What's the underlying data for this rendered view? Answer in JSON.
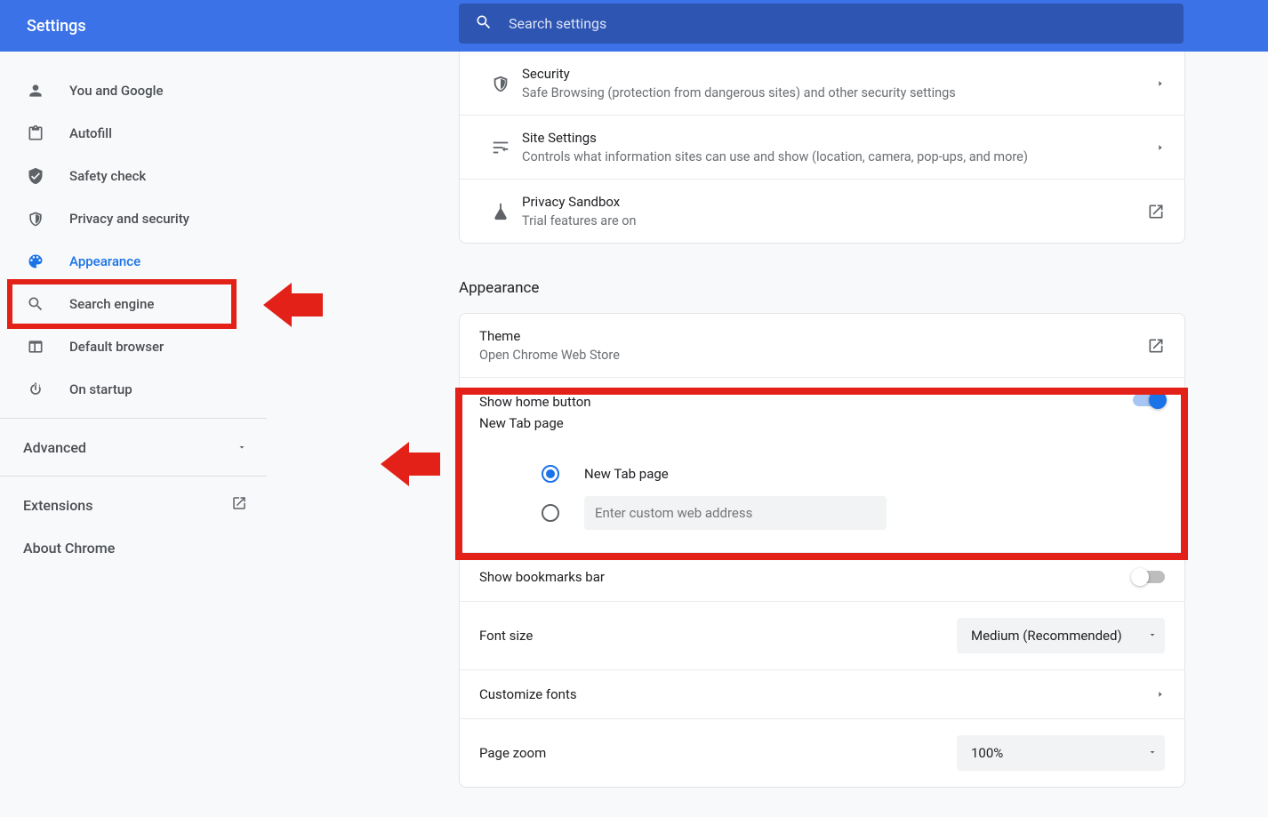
{
  "header": {
    "title": "Settings",
    "search_placeholder": "Search settings"
  },
  "sidebar": {
    "items": [
      {
        "label": "You and Google"
      },
      {
        "label": "Autofill"
      },
      {
        "label": "Safety check"
      },
      {
        "label": "Privacy and security"
      },
      {
        "label": "Appearance"
      },
      {
        "label": "Search engine"
      },
      {
        "label": "Default browser"
      },
      {
        "label": "On startup"
      }
    ],
    "advanced_label": "Advanced",
    "extensions_label": "Extensions",
    "about_label": "About Chrome"
  },
  "privacy_section": {
    "rows": [
      {
        "title": "Security",
        "sub": "Safe Browsing (protection from dangerous sites) and other security settings"
      },
      {
        "title": "Site Settings",
        "sub": "Controls what information sites can use and show (location, camera, pop-ups, and more)"
      },
      {
        "title": "Privacy Sandbox",
        "sub": "Trial features are on"
      }
    ]
  },
  "appearance": {
    "heading": "Appearance",
    "theme_title": "Theme",
    "theme_sub": "Open Chrome Web Store",
    "show_home_title": "Show home button",
    "show_home_sub": "New Tab page",
    "radio_newtab_label": "New Tab page",
    "custom_url_placeholder": "Enter custom web address",
    "show_bookmarks_label": "Show bookmarks bar",
    "font_size_label": "Font size",
    "font_size_value": "Medium (Recommended)",
    "customize_fonts_label": "Customize fonts",
    "page_zoom_label": "Page zoom",
    "page_zoom_value": "100%"
  }
}
